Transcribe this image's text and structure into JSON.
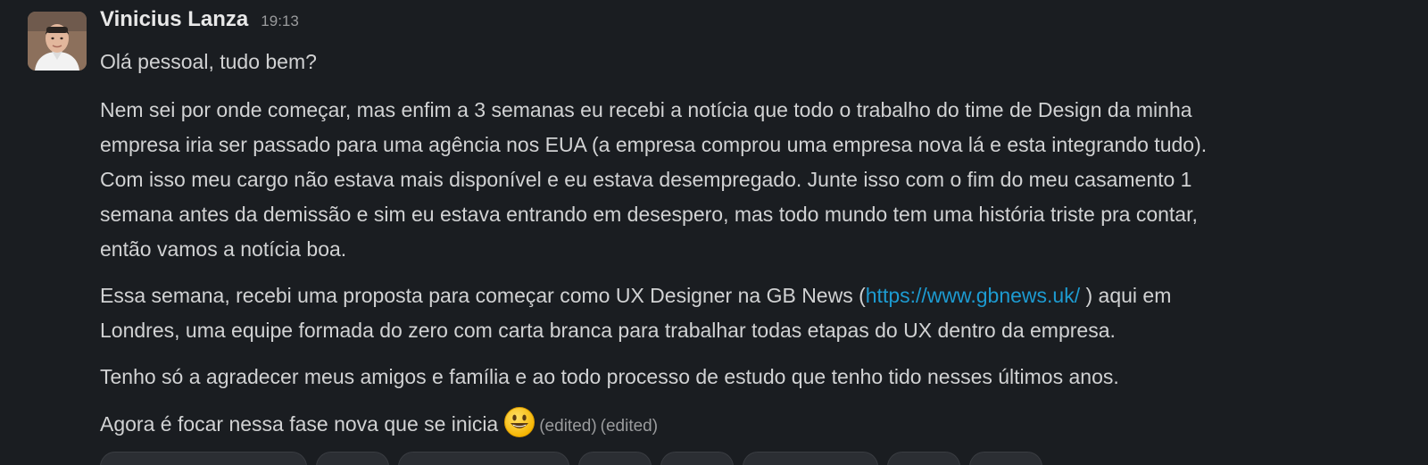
{
  "message": {
    "author": "Vinicius Lanza",
    "time": "19:13",
    "paragraphs": {
      "p0": "Olá pessoal, tudo bem?",
      "p1_lines": [
        "Nem sei por onde começar, mas enfim a 3 semanas eu recebi a notícia que todo o trabalho do time de Design da minha",
        "empresa iria ser passado para  uma agência nos EUA (a empresa comprou uma empresa nova lá e esta integrando tudo).",
        "Com isso meu cargo não estava mais disponível e eu estava desempregado. Junte isso com o fim do meu casamento 1",
        "semana antes da demissão e sim eu estava entrando em desespero, mas todo mundo tem uma história triste pra contar,",
        "então vamos a notícia boa."
      ],
      "p2_before_link": "Essa semana, recebi uma proposta para começar como UX Designer na GB News (",
      "p2_link": "https://www.gbnews.uk/",
      "p2_after_link": " ) aqui em",
      "p2_line2": "Londres, uma equipe formada do zero com carta branca para trabalhar todas etapas do UX dentro da empresa.",
      "p3": "Tenho só a agradecer meus amigos e família e ao todo processo de estudo que tenho tido nesses últimos anos.",
      "p4": "Agora é focar nessa fase nova que se inicia",
      "edited_1": "(edited)",
      "edited_2": "(edited)"
    },
    "emoji": "smiley-emoji",
    "avatar_icon": "user-avatar-photo"
  },
  "colors": {
    "background": "#1a1d21",
    "text": "#d1d2d3",
    "link": "#1d9bd1",
    "muted": "#9a9b9d"
  }
}
